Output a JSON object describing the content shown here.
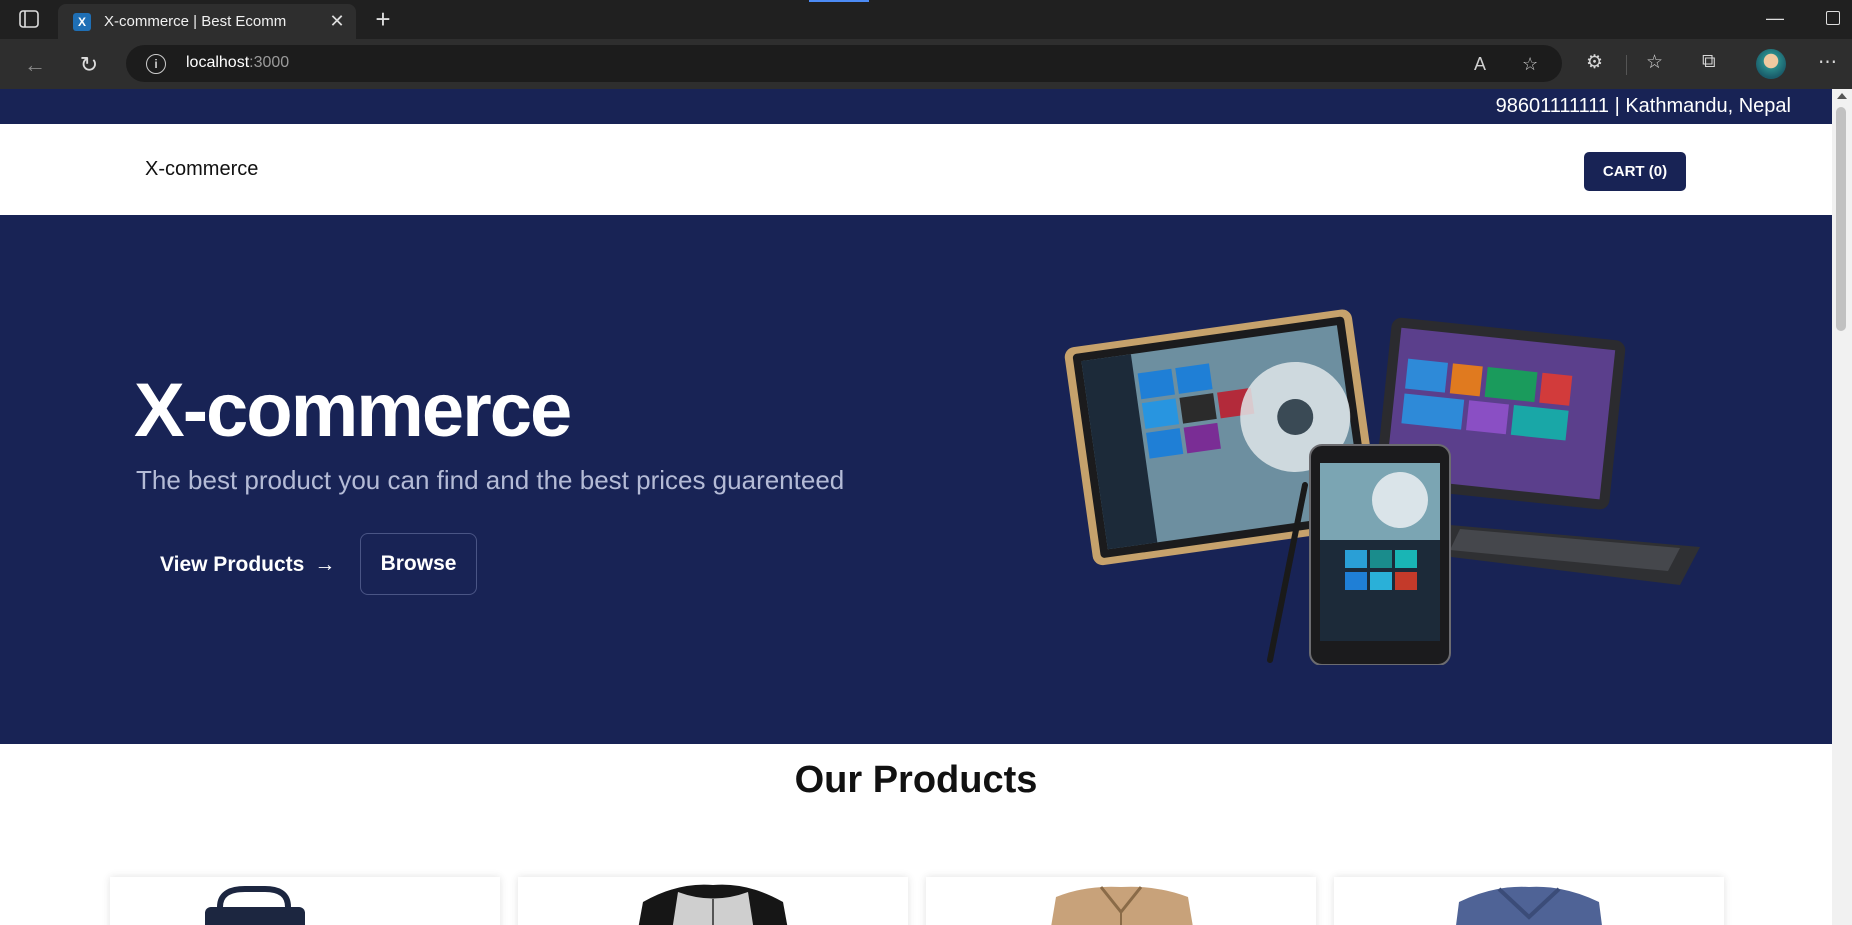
{
  "browser": {
    "tab_title": "X-commerce | Best Ecomm",
    "url_host": "localhost",
    "url_port": ":3000"
  },
  "page": {
    "topbar_text": "98601111111 | Kathmandu, Nepal",
    "brand": "X-commerce",
    "cart_label": "CART (0)",
    "hero": {
      "title": "X-commerce",
      "subtitle": "The best product you can find and the best prices guarenteed",
      "view_products_label": "View Products",
      "browse_label": "Browse"
    },
    "products_title": "Our Products",
    "products": [
      {
        "icon": "bag-product-image"
      },
      {
        "icon": "raglan-shirt-product-image"
      },
      {
        "icon": "jacket-product-image"
      },
      {
        "icon": "vneck-shirt-product-image"
      }
    ]
  },
  "colors": {
    "navy": "#182355",
    "chrome_dark": "#202020",
    "subtitle": "#b4bbd6"
  }
}
